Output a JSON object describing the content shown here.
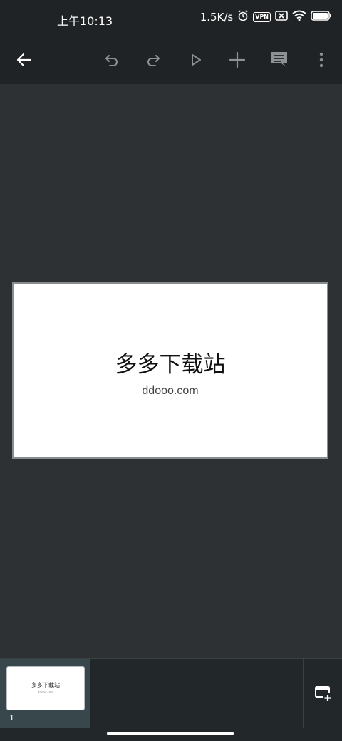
{
  "status_bar": {
    "time": "上午10:13",
    "network_speed": "1.5K/s",
    "vpn_label": "VPN",
    "icons": [
      "alarm-icon",
      "vpn-icon",
      "sim-disabled-icon",
      "wifi-icon",
      "battery-icon"
    ]
  },
  "toolbar": {
    "icons": [
      "back-arrow-icon",
      "undo-icon",
      "redo-icon",
      "play-icon",
      "add-icon",
      "comment-icon",
      "more-vert-icon"
    ]
  },
  "slide": {
    "title": "多多下载站",
    "subtitle": "ddooo.com"
  },
  "filmstrip": {
    "thumbnails": [
      {
        "title": "多多下载站",
        "subtitle": "ddooo.com",
        "number": "1"
      }
    ],
    "new_slide_icon": "new-slide-icon"
  },
  "colors": {
    "toolbar_bg": "#202325",
    "canvas_bg": "#2e3133",
    "thumb_selected_bg": "#37474c",
    "icon_enabled": "#ffffff",
    "icon_disabled": "#8d9194"
  }
}
